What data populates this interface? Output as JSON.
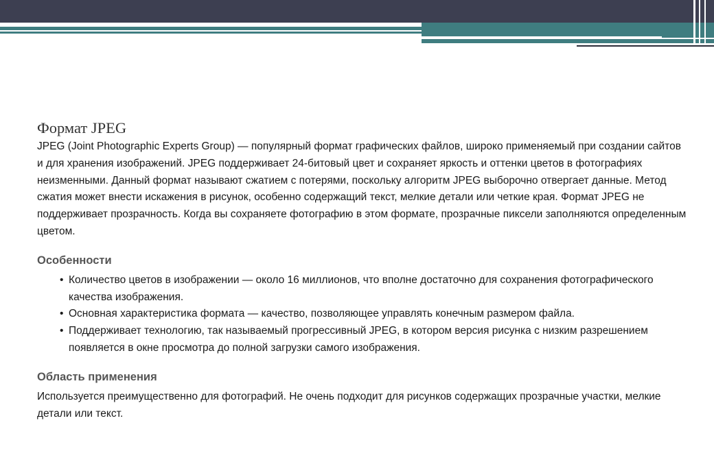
{
  "slide": {
    "title": "Формат JPEG",
    "intro": "JPEG (Joint Photographic Experts Group) — популярный формат графических файлов, широко применяемый при создании сайтов и для хранения изображений. JPEG поддерживает 24-битовый цвет и сохраняет яркость и оттенки цветов в фотографиях неизменными. Данный формат называют сжатием с потерями, поскольку алгоритм JPEG выборочно отвергает данные. Метод сжатия может внести искажения в рисунок, особенно содержащий текст, мелкие детали или четкие края. Формат JPEG не поддерживает прозрачность. Когда вы сохраняете фотографию в этом формате, прозрачные пиксели заполняются определенным цветом.",
    "features": {
      "heading": "Особенности",
      "items": [
        "Количество цветов в изображении — около 16 миллионов, что вполне достаточно для сохранения фотографического качества изображения.",
        "Основная характеристика формата — качество, позволяющее управлять конечным размером файла.",
        "Поддерживает технологию, так называемый прогрессивный JPEG, в котором версия рисунка с низким разрешением появляется в окне просмотра до полной загрузки самого изображения."
      ]
    },
    "usage": {
      "heading": "Область применения",
      "text": "Используется преимущественно для фотографий. Не очень подходит для рисунков содержащих прозрачные участки, мелкие детали или текст."
    }
  },
  "theme": {
    "header_color": "#3d3f51",
    "band_color": "#3f7d80",
    "heading_color": "#555555"
  }
}
